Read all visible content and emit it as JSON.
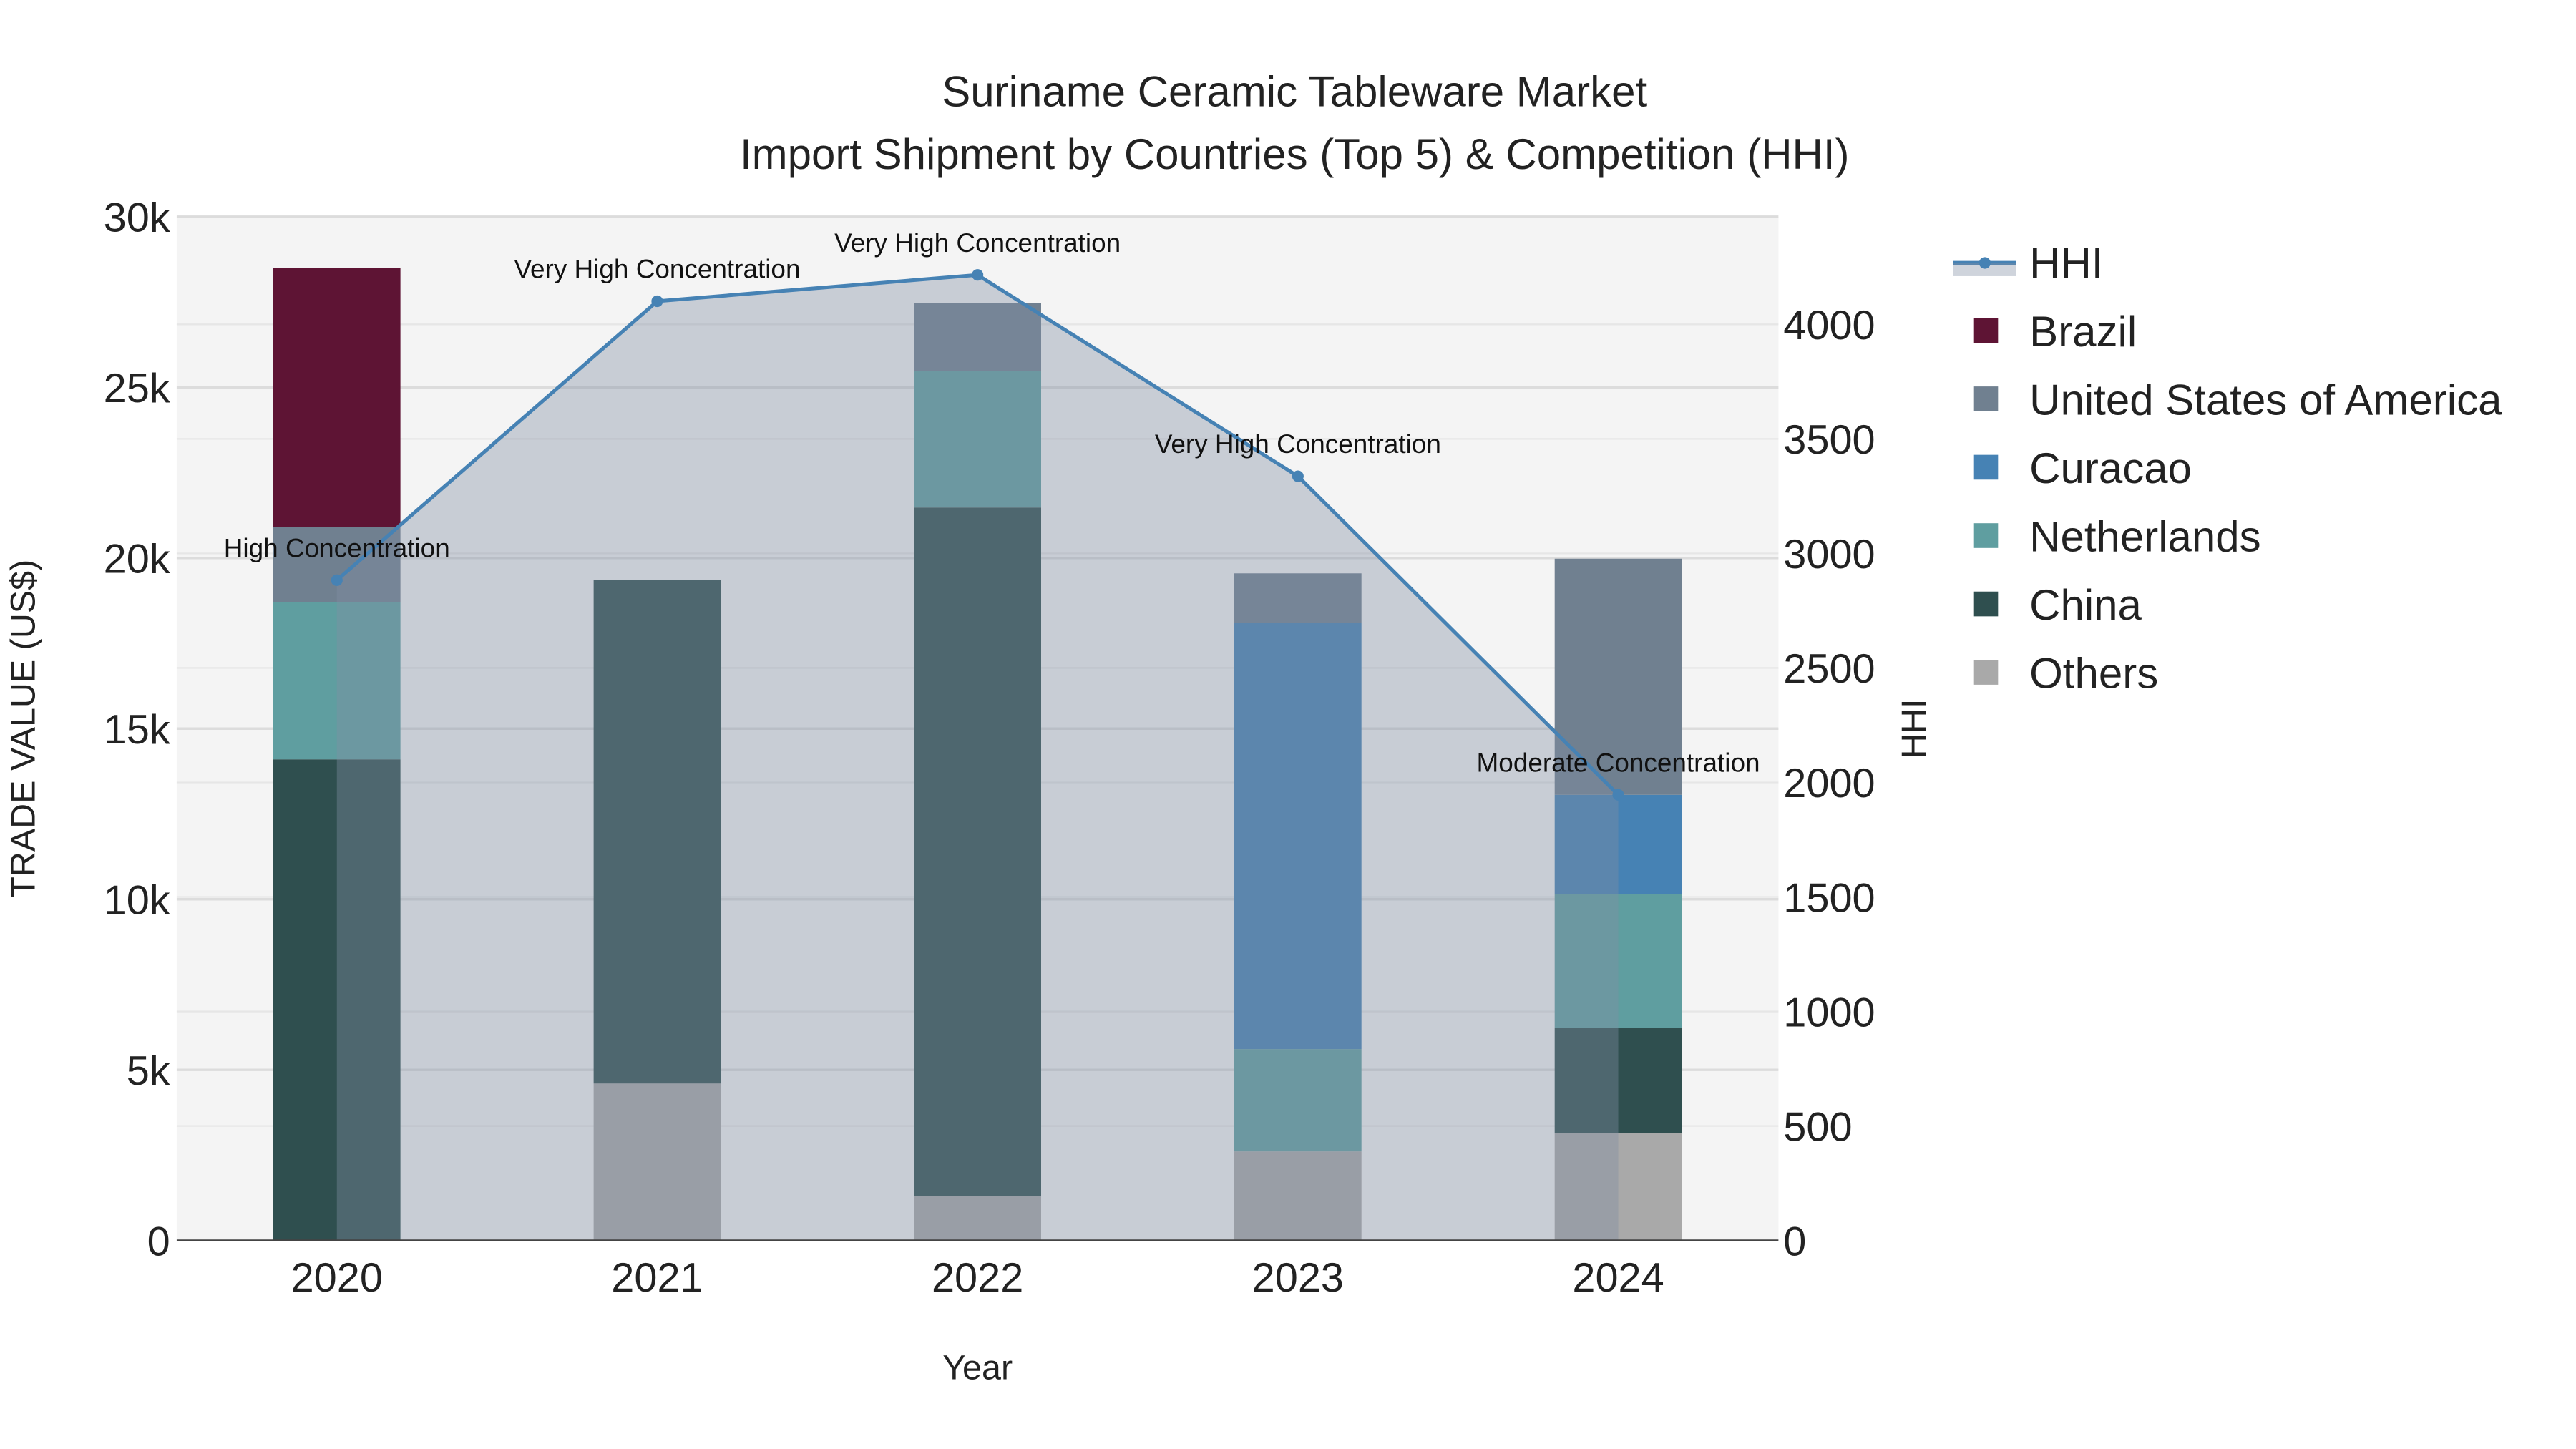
{
  "chart_data": {
    "type": "bar",
    "title": "Suriname Ceramic Tableware Market",
    "subtitle": "Import Shipment by Countries (Top 5) & Competition (HHI)",
    "xlabel": "Year",
    "ylabel": "TRADE VALUE (US$)",
    "y2label": "HHI",
    "ylim": [
      0,
      30000
    ],
    "y2lim": [
      0,
      4470
    ],
    "yticks": [
      {
        "v": 0,
        "label": "0"
      },
      {
        "v": 5000,
        "label": "5k"
      },
      {
        "v": 10000,
        "label": "10k"
      },
      {
        "v": 15000,
        "label": "15k"
      },
      {
        "v": 20000,
        "label": "20k"
      },
      {
        "v": 25000,
        "label": "25k"
      },
      {
        "v": 30000,
        "label": "30k"
      }
    ],
    "y2ticks": [
      {
        "v": 0,
        "label": "0"
      },
      {
        "v": 500,
        "label": "500"
      },
      {
        "v": 1000,
        "label": "1000"
      },
      {
        "v": 1500,
        "label": "1500"
      },
      {
        "v": 2000,
        "label": "2000"
      },
      {
        "v": 2500,
        "label": "2500"
      },
      {
        "v": 3000,
        "label": "3000"
      },
      {
        "v": 3500,
        "label": "3500"
      },
      {
        "v": 4000,
        "label": "4000"
      }
    ],
    "categories": [
      "2020",
      "2021",
      "2022",
      "2023",
      "2024"
    ],
    "stack_order": [
      "Others",
      "China",
      "Netherlands",
      "Curacao",
      "United States of America",
      "Brazil"
    ],
    "series": [
      {
        "name": "Brazil",
        "color": "#5e1434",
        "values": [
          7600,
          0,
          0,
          0,
          0
        ]
      },
      {
        "name": "United States of America",
        "color": "#708090",
        "values": [
          2200,
          0,
          2000,
          1460,
          6920
        ]
      },
      {
        "name": "Curacao",
        "color": "#4682b4",
        "values": [
          0,
          0,
          0,
          12480,
          2900
        ]
      },
      {
        "name": "Netherlands",
        "color": "#5f9ea0",
        "values": [
          4600,
          0,
          4000,
          3000,
          3920
        ]
      },
      {
        "name": "China",
        "color": "#2f4f4f",
        "values": [
          14100,
          14750,
          20170,
          0,
          3100
        ]
      },
      {
        "name": "Others",
        "color": "#a9a9a9",
        "values": [
          0,
          4600,
          1310,
          2610,
          3140
        ]
      }
    ],
    "hhi": {
      "name": "HHI",
      "color": "#4682b4",
      "values": [
        2883,
        4101,
        4216,
        3337,
        1946
      ],
      "annotations": [
        "High Concentration",
        "Very High Concentration",
        "Very High Concentration",
        "Very High Concentration",
        "Moderate Concentration"
      ]
    },
    "legend_position": "right",
    "grid": true
  }
}
